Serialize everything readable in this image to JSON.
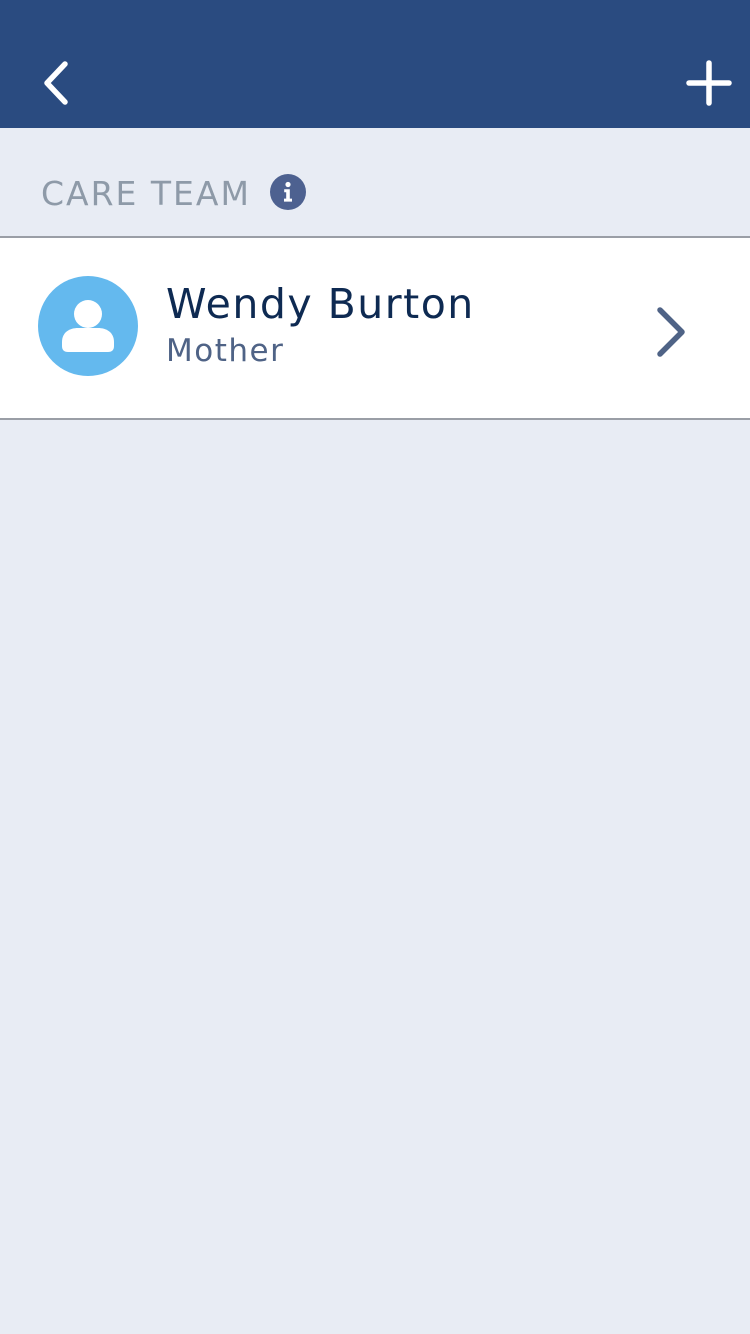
{
  "nav": {
    "back_icon": "chevron-left-icon",
    "add_icon": "plus-icon",
    "background_color": "#2a4b80"
  },
  "section": {
    "title": "CARE TEAM",
    "info_icon": "info-icon"
  },
  "care_team": [
    {
      "name": "Wendy Burton",
      "role": "Mother",
      "avatar_icon": "person-icon",
      "avatar_color": "#64b9ee",
      "chevron_icon": "chevron-right-icon"
    }
  ],
  "colors": {
    "page_background": "#e8ecf4",
    "name_text": "#0e2a52",
    "role_text": "#4f6386",
    "section_title": "#8e9aa8"
  }
}
